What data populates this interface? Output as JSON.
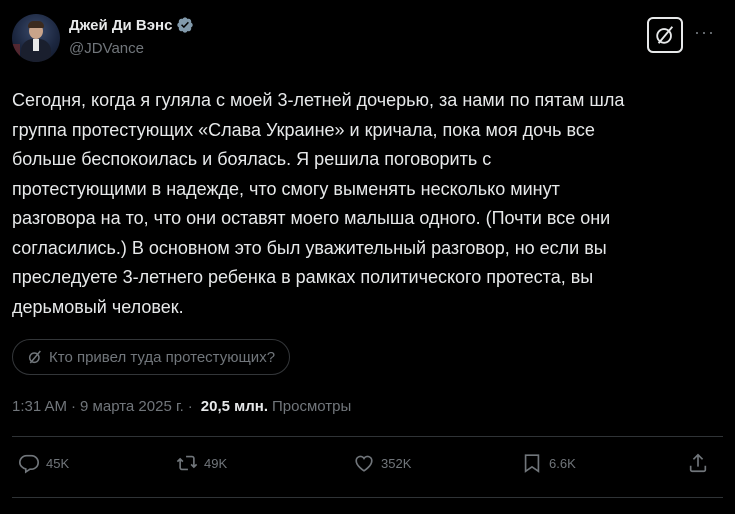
{
  "author": {
    "display_name": "Джей Ди Вэнс",
    "handle": "@JDVance",
    "verified": true
  },
  "tweet": {
    "lines": [
      "Сегодня, когда я гуляла с моей 3-летней дочерью, за нами по пятам шла",
      "группа протестующих «Слава Украине» и кричала, пока моя дочь все",
      "больше беспокоилась и боялась. Я решила поговорить с",
      "протестующими в надежде, что смогу выменять несколько минут",
      "разговора на то, что они оставят моего малыша одного. (Почти все они",
      "согласились.) В основном это был уважительный разговор, но если вы",
      "преследуете 3-летнего ребенка в рамках политического протеста, вы",
      "дерьмовый человек."
    ]
  },
  "grok_prompt": "Кто привел туда протестующих?",
  "meta": {
    "time": "1:31 AM",
    "date": "9 марта 2025 г.",
    "separator": "·",
    "views_count": "20,5 млн.",
    "views_label": "Просмотры"
  },
  "actions": {
    "replies": "45K",
    "reposts": "49K",
    "likes": "352K",
    "bookmarks": "6.6K"
  },
  "colors": {
    "background": "#000000",
    "text": "#e7e9ea",
    "muted": "#71767b",
    "verified": "#829aab",
    "border": "#2f3336"
  },
  "icons": [
    "grok-icon",
    "more-icon",
    "reply-icon",
    "repost-icon",
    "like-icon",
    "bookmark-icon",
    "share-icon",
    "verified-badge-icon"
  ]
}
